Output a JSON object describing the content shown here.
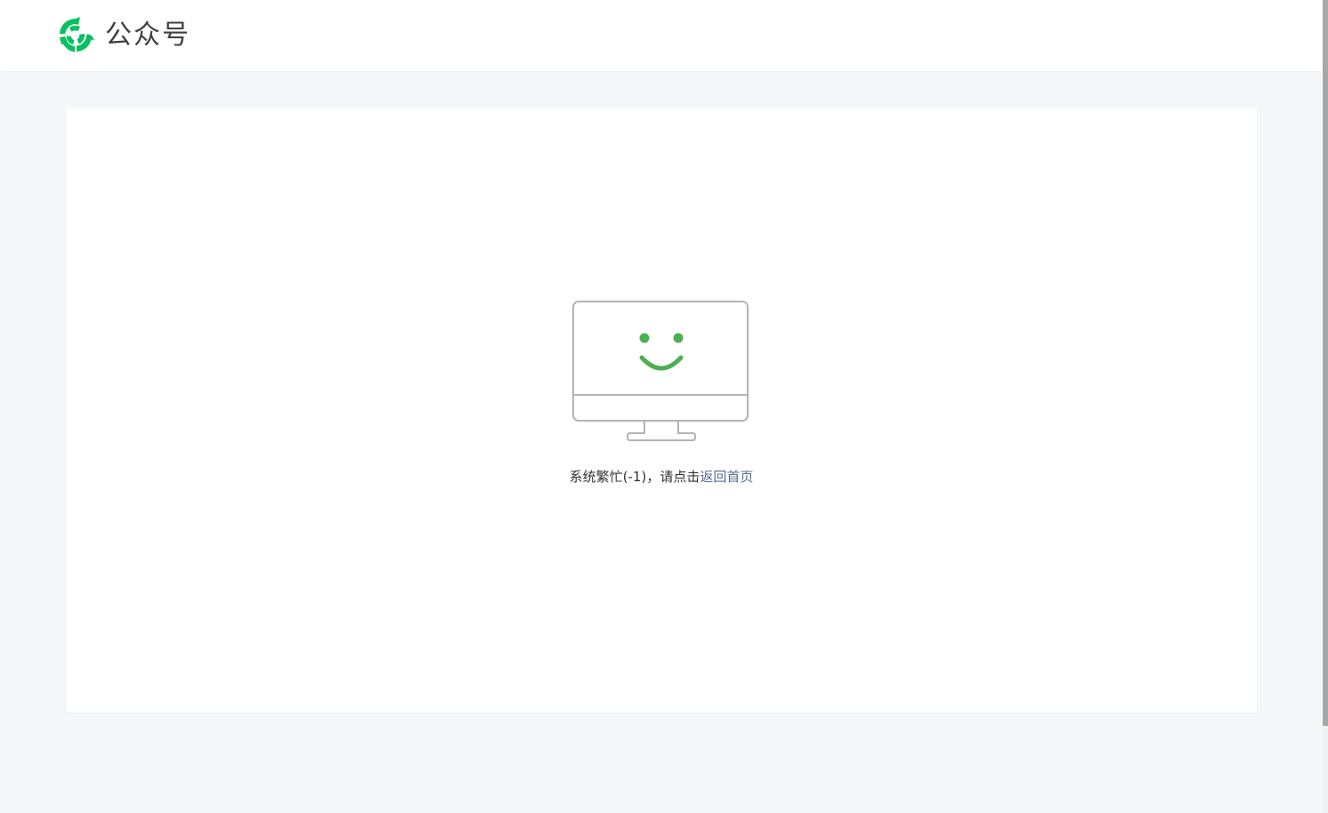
{
  "header": {
    "logo_icon": "wechat-official-accounts-logo-icon",
    "title": "公众号"
  },
  "error": {
    "illustration_icon": "smiling-monitor-icon",
    "message_prefix": "系统繁忙(-1)，请点击",
    "link_label": "返回首页"
  },
  "colors": {
    "brand_green": "#07c160",
    "illustration_green": "#4caf50",
    "link_blue": "#576b95",
    "page_background": "#f6f7f9"
  }
}
